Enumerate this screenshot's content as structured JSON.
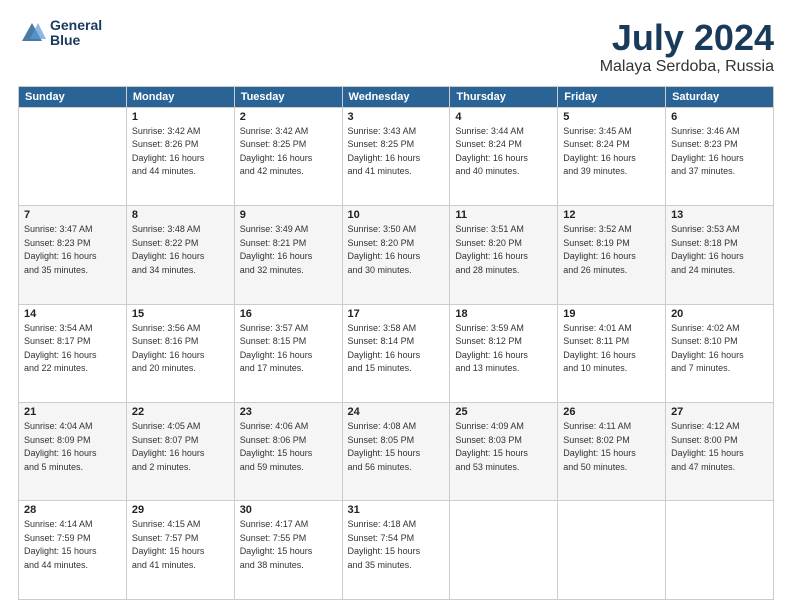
{
  "logo": {
    "line1": "General",
    "line2": "Blue"
  },
  "title": {
    "month_year": "July 2024",
    "location": "Malaya Serdoba, Russia"
  },
  "weekdays": [
    "Sunday",
    "Monday",
    "Tuesday",
    "Wednesday",
    "Thursday",
    "Friday",
    "Saturday"
  ],
  "weeks": [
    [
      {
        "day": "",
        "info": ""
      },
      {
        "day": "1",
        "info": "Sunrise: 3:42 AM\nSunset: 8:26 PM\nDaylight: 16 hours\nand 44 minutes."
      },
      {
        "day": "2",
        "info": "Sunrise: 3:42 AM\nSunset: 8:25 PM\nDaylight: 16 hours\nand 42 minutes."
      },
      {
        "day": "3",
        "info": "Sunrise: 3:43 AM\nSunset: 8:25 PM\nDaylight: 16 hours\nand 41 minutes."
      },
      {
        "day": "4",
        "info": "Sunrise: 3:44 AM\nSunset: 8:24 PM\nDaylight: 16 hours\nand 40 minutes."
      },
      {
        "day": "5",
        "info": "Sunrise: 3:45 AM\nSunset: 8:24 PM\nDaylight: 16 hours\nand 39 minutes."
      },
      {
        "day": "6",
        "info": "Sunrise: 3:46 AM\nSunset: 8:23 PM\nDaylight: 16 hours\nand 37 minutes."
      }
    ],
    [
      {
        "day": "7",
        "info": "Sunrise: 3:47 AM\nSunset: 8:23 PM\nDaylight: 16 hours\nand 35 minutes."
      },
      {
        "day": "8",
        "info": "Sunrise: 3:48 AM\nSunset: 8:22 PM\nDaylight: 16 hours\nand 34 minutes."
      },
      {
        "day": "9",
        "info": "Sunrise: 3:49 AM\nSunset: 8:21 PM\nDaylight: 16 hours\nand 32 minutes."
      },
      {
        "day": "10",
        "info": "Sunrise: 3:50 AM\nSunset: 8:20 PM\nDaylight: 16 hours\nand 30 minutes."
      },
      {
        "day": "11",
        "info": "Sunrise: 3:51 AM\nSunset: 8:20 PM\nDaylight: 16 hours\nand 28 minutes."
      },
      {
        "day": "12",
        "info": "Sunrise: 3:52 AM\nSunset: 8:19 PM\nDaylight: 16 hours\nand 26 minutes."
      },
      {
        "day": "13",
        "info": "Sunrise: 3:53 AM\nSunset: 8:18 PM\nDaylight: 16 hours\nand 24 minutes."
      }
    ],
    [
      {
        "day": "14",
        "info": "Sunrise: 3:54 AM\nSunset: 8:17 PM\nDaylight: 16 hours\nand 22 minutes."
      },
      {
        "day": "15",
        "info": "Sunrise: 3:56 AM\nSunset: 8:16 PM\nDaylight: 16 hours\nand 20 minutes."
      },
      {
        "day": "16",
        "info": "Sunrise: 3:57 AM\nSunset: 8:15 PM\nDaylight: 16 hours\nand 17 minutes."
      },
      {
        "day": "17",
        "info": "Sunrise: 3:58 AM\nSunset: 8:14 PM\nDaylight: 16 hours\nand 15 minutes."
      },
      {
        "day": "18",
        "info": "Sunrise: 3:59 AM\nSunset: 8:12 PM\nDaylight: 16 hours\nand 13 minutes."
      },
      {
        "day": "19",
        "info": "Sunrise: 4:01 AM\nSunset: 8:11 PM\nDaylight: 16 hours\nand 10 minutes."
      },
      {
        "day": "20",
        "info": "Sunrise: 4:02 AM\nSunset: 8:10 PM\nDaylight: 16 hours\nand 7 minutes."
      }
    ],
    [
      {
        "day": "21",
        "info": "Sunrise: 4:04 AM\nSunset: 8:09 PM\nDaylight: 16 hours\nand 5 minutes."
      },
      {
        "day": "22",
        "info": "Sunrise: 4:05 AM\nSunset: 8:07 PM\nDaylight: 16 hours\nand 2 minutes."
      },
      {
        "day": "23",
        "info": "Sunrise: 4:06 AM\nSunset: 8:06 PM\nDaylight: 15 hours\nand 59 minutes."
      },
      {
        "day": "24",
        "info": "Sunrise: 4:08 AM\nSunset: 8:05 PM\nDaylight: 15 hours\nand 56 minutes."
      },
      {
        "day": "25",
        "info": "Sunrise: 4:09 AM\nSunset: 8:03 PM\nDaylight: 15 hours\nand 53 minutes."
      },
      {
        "day": "26",
        "info": "Sunrise: 4:11 AM\nSunset: 8:02 PM\nDaylight: 15 hours\nand 50 minutes."
      },
      {
        "day": "27",
        "info": "Sunrise: 4:12 AM\nSunset: 8:00 PM\nDaylight: 15 hours\nand 47 minutes."
      }
    ],
    [
      {
        "day": "28",
        "info": "Sunrise: 4:14 AM\nSunset: 7:59 PM\nDaylight: 15 hours\nand 44 minutes."
      },
      {
        "day": "29",
        "info": "Sunrise: 4:15 AM\nSunset: 7:57 PM\nDaylight: 15 hours\nand 41 minutes."
      },
      {
        "day": "30",
        "info": "Sunrise: 4:17 AM\nSunset: 7:55 PM\nDaylight: 15 hours\nand 38 minutes."
      },
      {
        "day": "31",
        "info": "Sunrise: 4:18 AM\nSunset: 7:54 PM\nDaylight: 15 hours\nand 35 minutes."
      },
      {
        "day": "",
        "info": ""
      },
      {
        "day": "",
        "info": ""
      },
      {
        "day": "",
        "info": ""
      }
    ]
  ]
}
